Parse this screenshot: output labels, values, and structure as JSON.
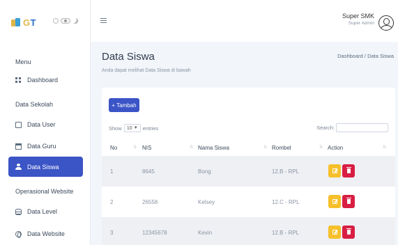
{
  "brand": {
    "name_part1": "G",
    "name_part2": "T"
  },
  "sidebar": {
    "sections": [
      {
        "label": "Menu"
      },
      {
        "label": "Data Sekolah"
      },
      {
        "label": "Operasional Website"
      }
    ],
    "items": [
      {
        "label": "Dashboard",
        "icon": "dashboard-grid-icon"
      },
      {
        "label": "Data User",
        "icon": "user-box-icon"
      },
      {
        "label": "Data Guru",
        "icon": "chalkboard-icon"
      },
      {
        "label": "Data Siswa",
        "icon": "student-icon",
        "active": true
      },
      {
        "label": "Data Level",
        "icon": "database-icon"
      },
      {
        "label": "Data Website",
        "icon": "globe-icon"
      }
    ]
  },
  "topbar": {
    "user_name": "Super SMK",
    "user_role": "Super Admin"
  },
  "page": {
    "title": "Data Siswa",
    "subtitle": "Anda dapat melihat Data Siswa di bawah",
    "breadcrumb": "Dashboard / Data Siswa"
  },
  "controls": {
    "add_label": "+ Tambah",
    "show_label": "Show",
    "entries_value": "10",
    "entries_label": "entries",
    "search_label": "Search:",
    "search_value": ""
  },
  "table": {
    "headers": [
      "No",
      "NIS",
      "Nama Siswa",
      "Rombel",
      "Action"
    ],
    "rows": [
      {
        "no": "1",
        "nis": "8645",
        "nama": "Bong",
        "rombel": "12.B - RPL"
      },
      {
        "no": "2",
        "nis": "26558",
        "nama": "Kelsey",
        "rombel": "12.C - RPL"
      },
      {
        "no": "3",
        "nis": "12345678",
        "nama": "Kevin",
        "rombel": "12.B - RPL"
      }
    ]
  },
  "colors": {
    "primary": "#3b54c6",
    "edit": "#f7c02b",
    "delete": "#d81e42"
  }
}
